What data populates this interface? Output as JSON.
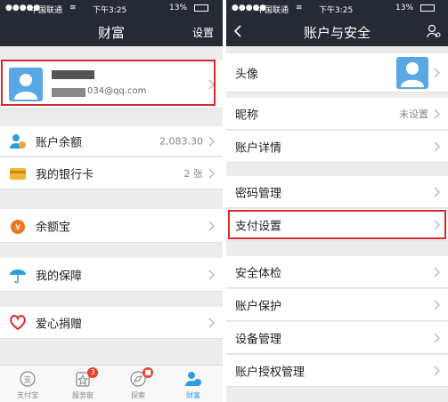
{
  "status_bar": {
    "carrier": "中国联通",
    "time": "下午3:25",
    "battery": "13%"
  },
  "wealth_screen": {
    "title": "财富",
    "settings": "设置",
    "profile": {
      "name": "",
      "email": "034@qq.com"
    },
    "rows": [
      {
        "label": "账户余额",
        "value": "2,083.30",
        "icon": "balance-icon"
      },
      {
        "label": "我的银行卡",
        "value": "2 张",
        "icon": "bank-card-icon"
      },
      {
        "label": "余额宝",
        "icon": "yuebao-icon"
      },
      {
        "label": "我的保障",
        "icon": "umbrella-icon"
      },
      {
        "label": "爱心捐赠",
        "icon": "heart-icon"
      }
    ],
    "tabbar": [
      {
        "label": "支付宝",
        "icon": "alipay-tab-icon",
        "badge": ""
      },
      {
        "label": "服务窗",
        "icon": "service-window-tab-icon",
        "badge": "3"
      },
      {
        "label": "探索",
        "icon": "explore-tab-icon",
        "badge": ""
      },
      {
        "label": "财富",
        "icon": "wealth-tab-icon",
        "badge": ""
      }
    ],
    "colors": {
      "active_tab": "#2e9ddb",
      "accent": "#2e9ddb",
      "highlight_border": "#d8282f"
    }
  },
  "account_screen": {
    "title": "账户与安全",
    "rows": [
      {
        "label": "头像"
      },
      {
        "label": "昵称",
        "value": "未设置"
      },
      {
        "label": "账户详情"
      },
      {
        "label": "密码管理"
      },
      {
        "label": "支付设置"
      },
      {
        "label": "安全体检"
      },
      {
        "label": "账户保护"
      },
      {
        "label": "设备管理"
      },
      {
        "label": "账户授权管理"
      }
    ]
  }
}
